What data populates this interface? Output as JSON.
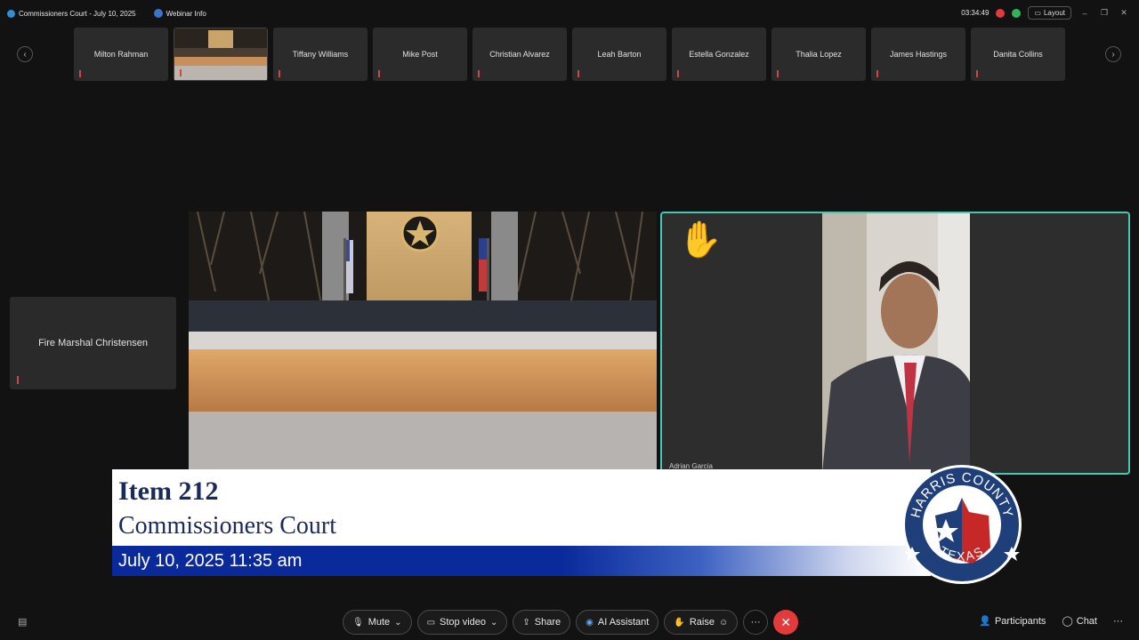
{
  "window": {
    "title": "Commissioners Court - July 10, 2025",
    "webinar_info": "Webinar Info",
    "timer": "03:34:49",
    "layout_label": "Layout"
  },
  "participants_strip": [
    {
      "name": "Milton Rahman",
      "video": false
    },
    {
      "name": "",
      "video": true
    },
    {
      "name": "Tiffany Williams",
      "video": false
    },
    {
      "name": "Mike Post",
      "video": false
    },
    {
      "name": "Christian Alvarez",
      "video": false
    },
    {
      "name": "Leah Barton",
      "video": false
    },
    {
      "name": "Estella Gonzalez",
      "video": false
    },
    {
      "name": "Thalia Lopez",
      "video": false
    },
    {
      "name": "James Hastings",
      "video": false
    },
    {
      "name": "Danita Collins",
      "video": false
    }
  ],
  "side_tile": {
    "name": "Fire Marshal Christensen"
  },
  "speaker": {
    "name": "Adrian Garcia"
  },
  "lower_third": {
    "item": "Item 212",
    "subtitle": "Commissioners Court",
    "datetime": "July 10, 2025 11:35 am",
    "seal_top": "HARRIS COUNTY",
    "seal_bottom": "TEXAS"
  },
  "controls": {
    "mute": "Mute",
    "stop_video": "Stop video",
    "share": "Share",
    "ai_assistant": "AI Assistant",
    "raise": "Raise",
    "participants": "Participants",
    "chat": "Chat"
  },
  "colors": {
    "active_border": "#43c9b4",
    "end_call": "#e33b3b",
    "banner_blue": "#0a2a9b"
  }
}
